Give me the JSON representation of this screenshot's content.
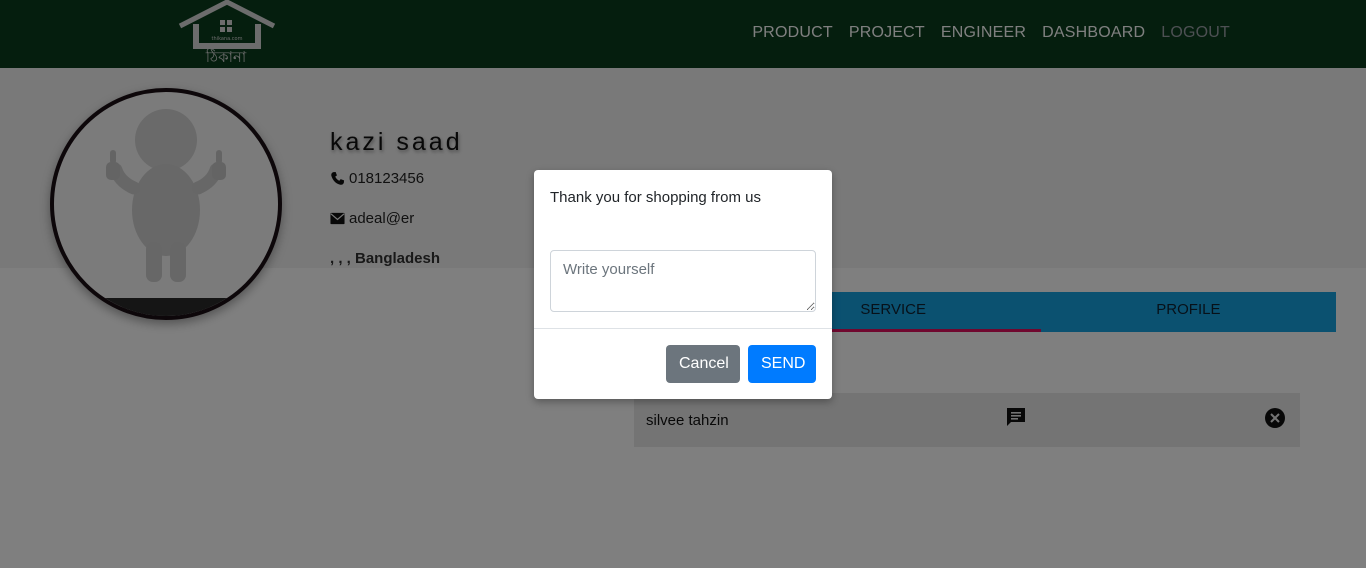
{
  "header": {
    "logo_small_text": "thikana.com",
    "logo_text": "ঠিকানা",
    "nav": [
      {
        "label": "PRODUCT"
      },
      {
        "label": "PROJECT"
      },
      {
        "label": "ENGINEER"
      },
      {
        "label": "DASHBOARD"
      },
      {
        "label": "LOGOUT"
      }
    ]
  },
  "profile": {
    "name": "kazi saad",
    "phone": "018123456",
    "email": "adeal@er",
    "address": ", , , Bangladesh"
  },
  "tabs": [
    {
      "label": "SERVICE",
      "active": true
    },
    {
      "label": "PROFILE",
      "active": false
    }
  ],
  "chats": [
    {
      "name": "silvee tahzin"
    }
  ],
  "modal": {
    "message": "Thank you for shopping from us",
    "textarea_placeholder": "Write yourself",
    "cancel_label": "Cancel",
    "send_label": "SEND"
  },
  "colors": {
    "navbar": "#0b3d1d",
    "tab_bar": "#17a2e0",
    "tab_active_underline": "#e0115f",
    "send_button": "#007bff",
    "cancel_button": "#6c757d"
  }
}
